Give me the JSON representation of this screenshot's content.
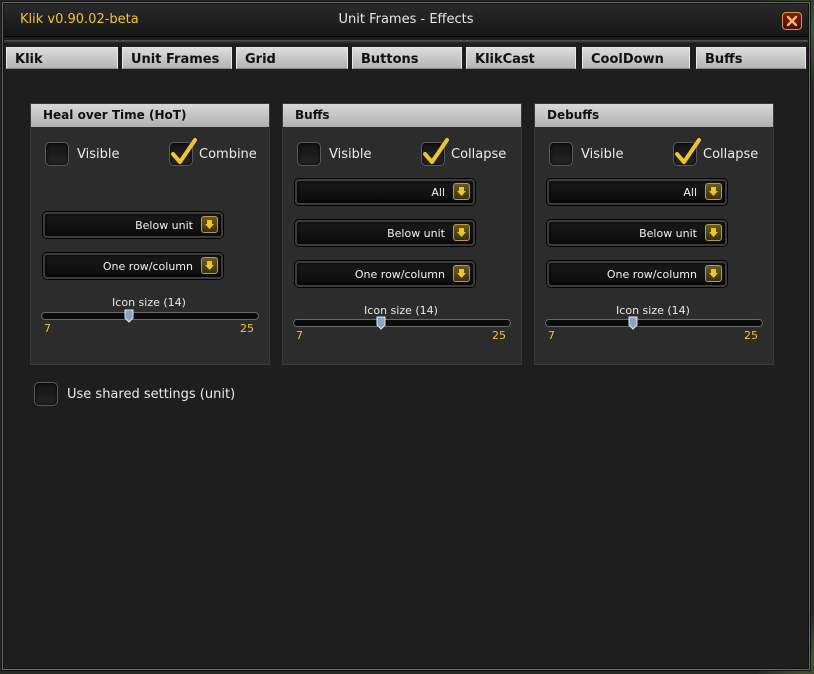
{
  "app": {
    "title": "Klik v0.90.02-beta",
    "window_title": "Unit Frames - Effects"
  },
  "tabs": [
    {
      "label": "Klik"
    },
    {
      "label": "Unit Frames"
    },
    {
      "label": "Grid"
    },
    {
      "label": "Buttons"
    },
    {
      "label": "KlikCast"
    },
    {
      "label": "CoolDown"
    },
    {
      "label": "Buffs"
    }
  ],
  "panels": [
    {
      "title": "Heal over Time (HoT)",
      "visible": {
        "label": "Visible",
        "checked": false
      },
      "second": {
        "label": "Combine",
        "checked": true
      },
      "dropdowns": [
        "Below unit",
        "One row/column"
      ],
      "slider": {
        "label": "Icon size (14)",
        "min": "7",
        "max": "25",
        "value": 14
      }
    },
    {
      "title": "Buffs",
      "visible": {
        "label": "Visible",
        "checked": false
      },
      "second": {
        "label": "Collapse",
        "checked": true
      },
      "dropdowns": [
        "All",
        "Below unit",
        "One row/column"
      ],
      "slider": {
        "label": "Icon size (14)",
        "min": "7",
        "max": "25",
        "value": 14
      }
    },
    {
      "title": "Debuffs",
      "visible": {
        "label": "Visible",
        "checked": false
      },
      "second": {
        "label": "Collapse",
        "checked": true
      },
      "dropdowns": [
        "All",
        "Below unit",
        "One row/column"
      ],
      "slider": {
        "label": "Icon size (14)",
        "min": "7",
        "max": "25",
        "value": 14
      }
    }
  ],
  "shared": {
    "label": "Use shared settings (unit)",
    "checked": false
  },
  "colors": {
    "gold": "#f0c52a",
    "panel_bg": "#2c2c2c",
    "window_bg": "#1e1e1e"
  },
  "icons": {
    "close": "close-icon",
    "check": "checkmark-icon",
    "arrow": "arrow-down-icon"
  }
}
